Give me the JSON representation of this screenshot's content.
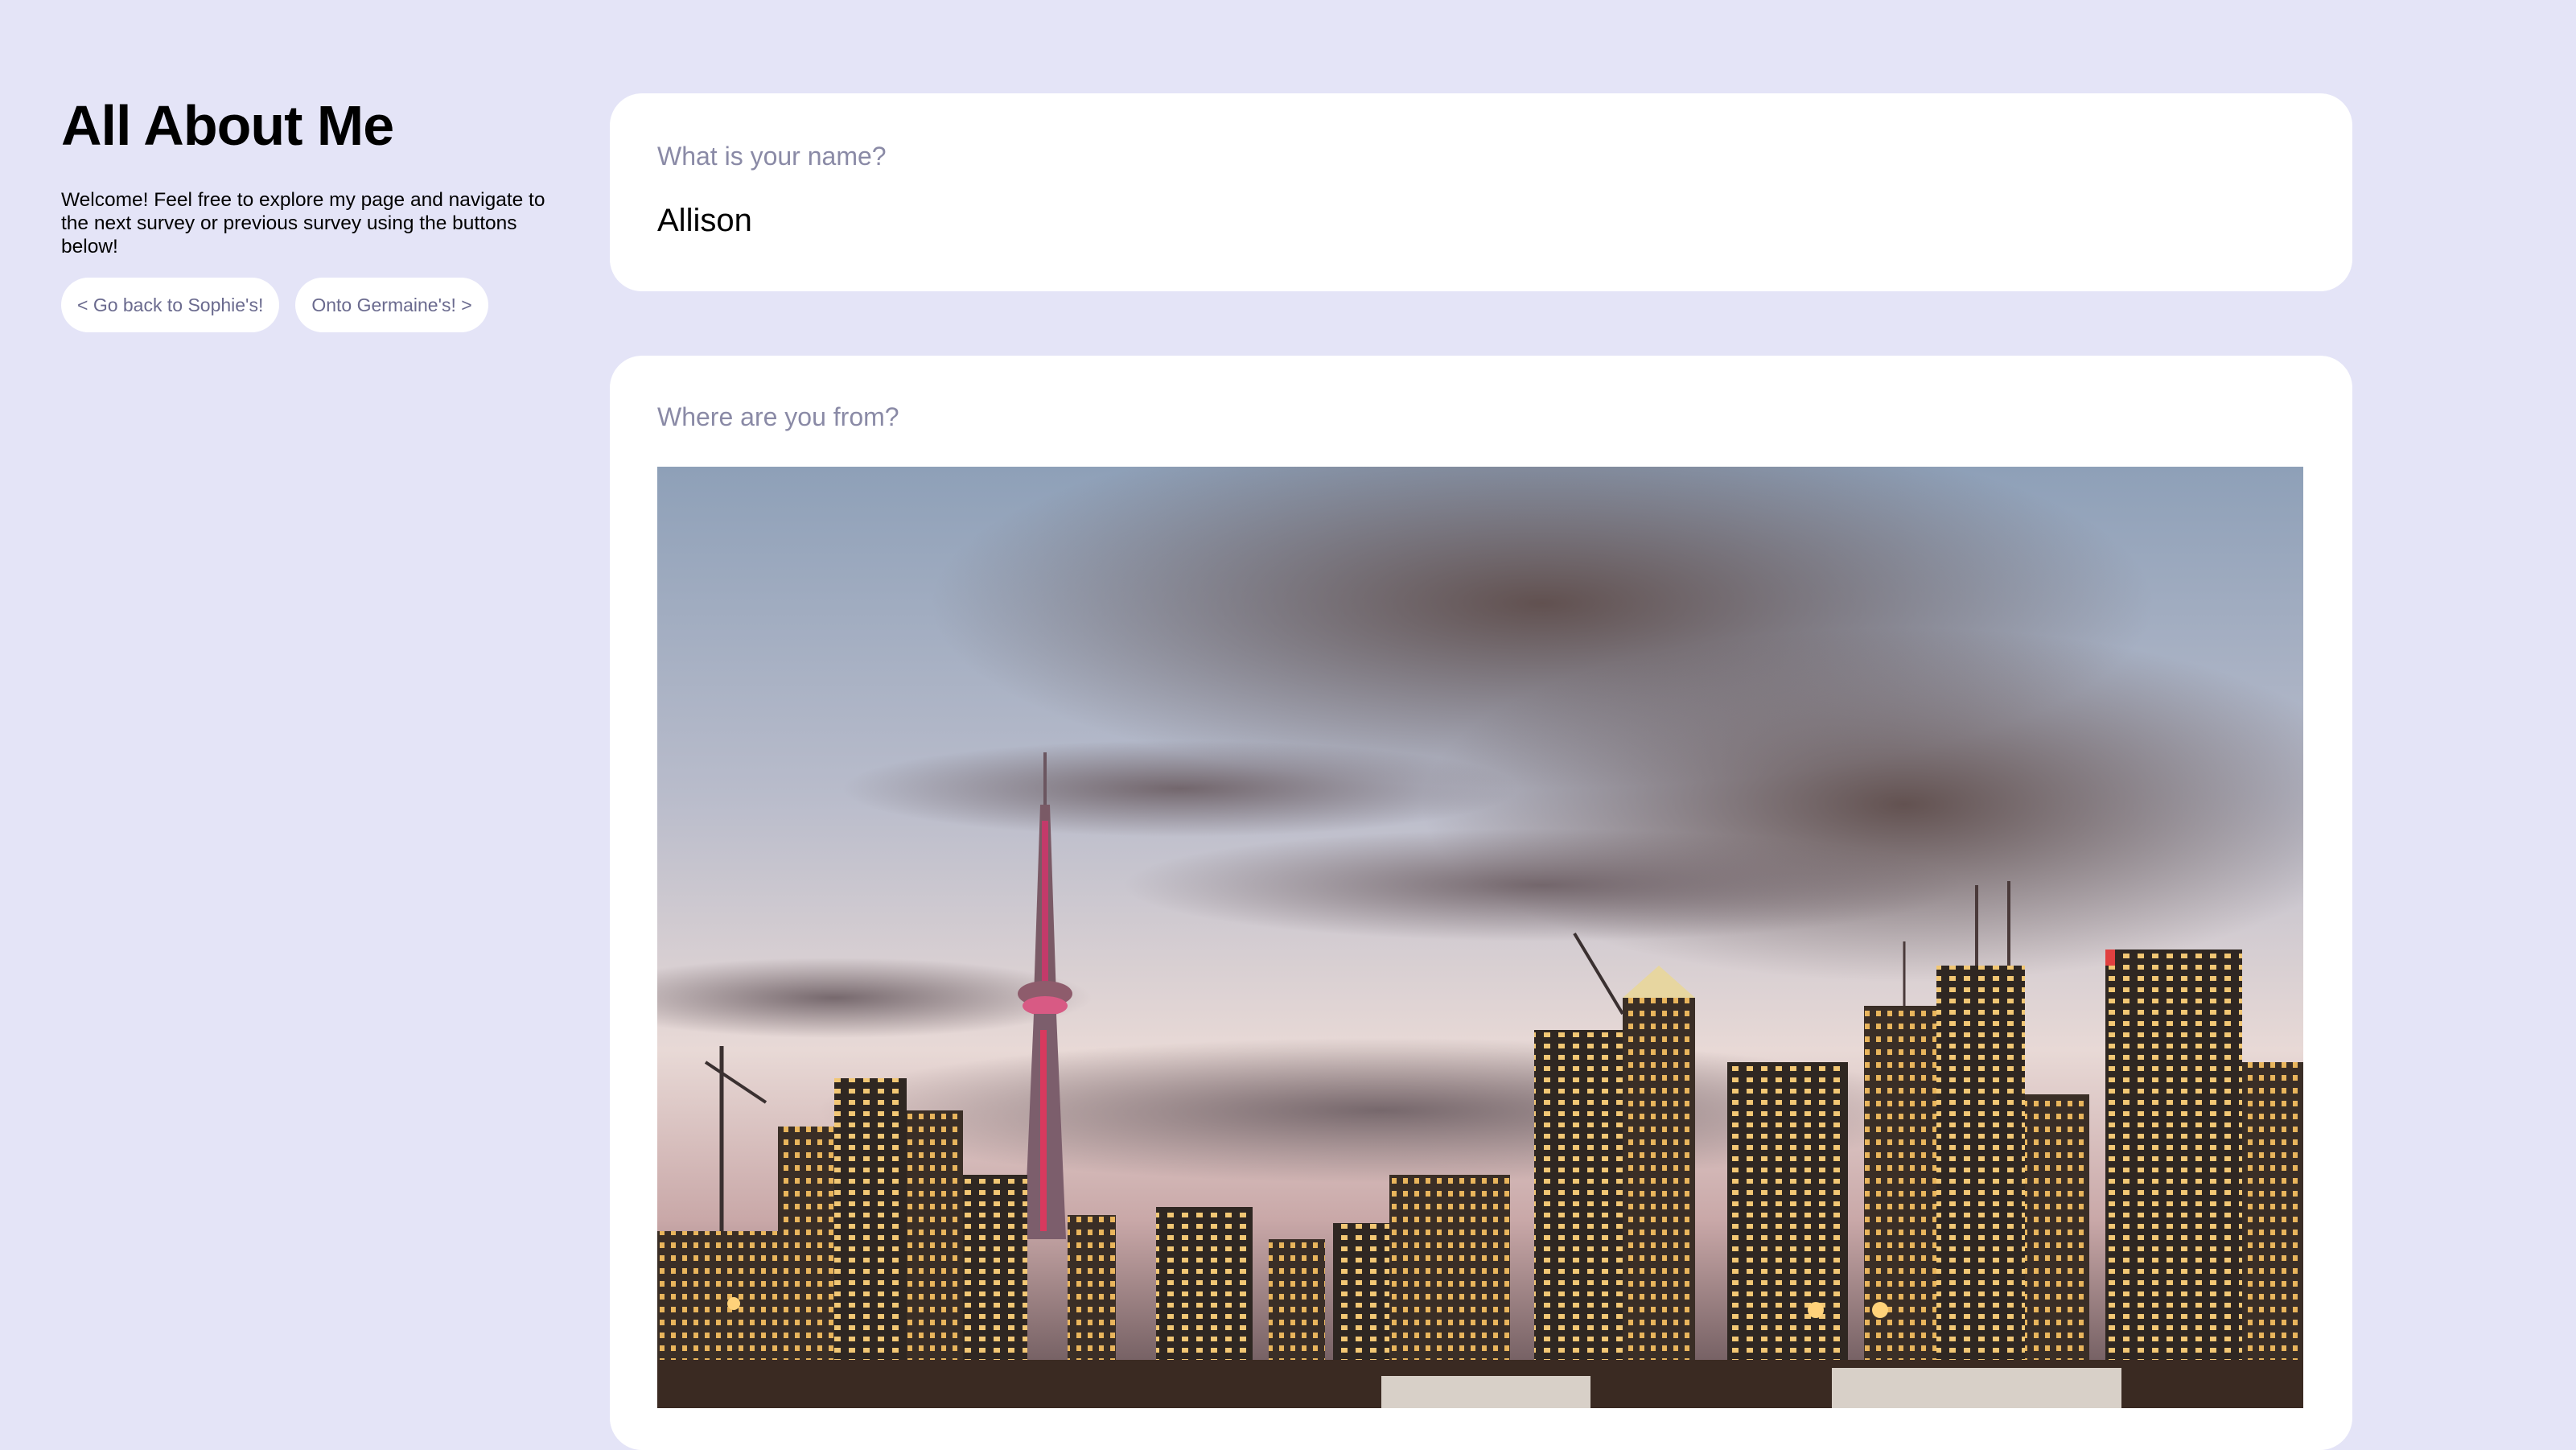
{
  "sidebar": {
    "title": "All About Me",
    "intro": "Welcome! Feel free to explore my page and navigate to the next survey or previous survey using the buttons below!",
    "prev_button": "< Go back to Sophie's!",
    "next_button": "Onto Germaine's! >"
  },
  "questions": [
    {
      "label": "What is your name?",
      "answer": "Allison"
    },
    {
      "label": "Where are you from?",
      "image_alt": "Toronto skyline at dusk with the CN Tower"
    }
  ],
  "colors": {
    "background": "#e4e4f7",
    "card": "#ffffff",
    "question_text": "#8a8aa6",
    "button_text": "#6a6a8e"
  }
}
